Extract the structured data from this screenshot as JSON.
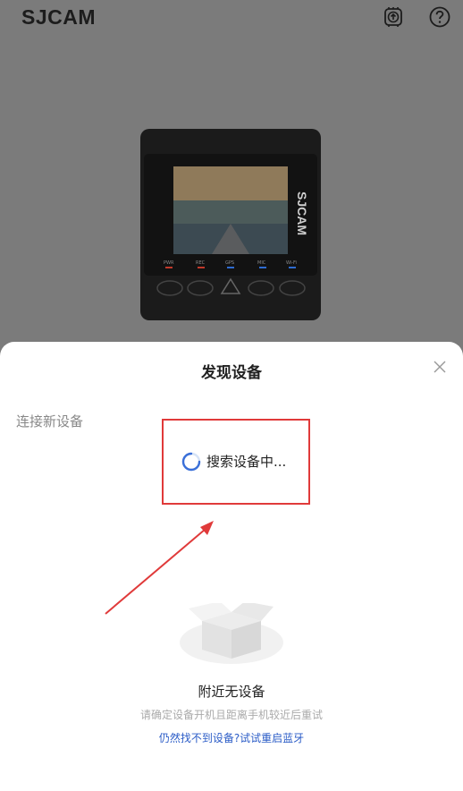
{
  "app": {
    "logo": "SJCAM"
  },
  "header": {
    "icons": [
      "upload-board-icon",
      "help-icon"
    ]
  },
  "dialog": {
    "title": "发现设备",
    "section_label": "连接新设备",
    "searching_text": "搜索设备中...",
    "empty_title": "附近无设备",
    "empty_hint": "请确定设备开机且距离手机较近后重试",
    "retry_link": "仍然找不到设备?试试重启蓝牙"
  },
  "camera": {
    "brand": "SJCAM",
    "indicators": [
      "PWR",
      "REC",
      "GPS",
      "MIC",
      "Wi-Fi"
    ]
  },
  "colors": {
    "highlight": "#e03a3a",
    "link": "#2b5cc7",
    "overlay": "#7b7b7b"
  }
}
